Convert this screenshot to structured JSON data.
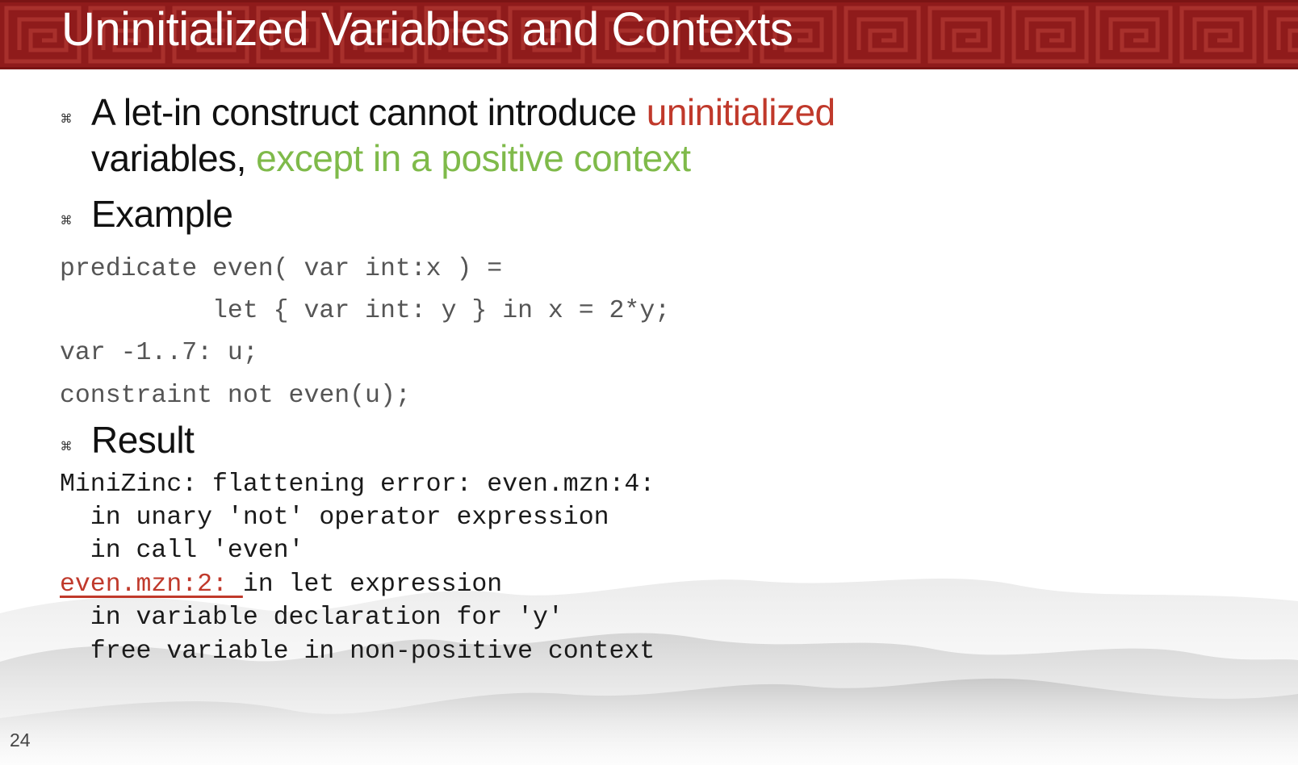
{
  "slide": {
    "title": "Uninitialized Variables and Contexts",
    "page_number": "24"
  },
  "bullets": [
    {
      "line1_a": "A let-in construct cannot introduce ",
      "line1_b": "uninitialized",
      "line2_a": "variables, ",
      "line2_b": "except in a positive context"
    },
    {
      "label": "Example"
    },
    {
      "label": "Result"
    }
  ],
  "example_code": [
    "predicate even( var int:x ) =",
    "          let { var int: y } in x = 2*y;",
    "var -1..7: u;",
    "constraint not even(u);"
  ],
  "result_output": {
    "line1": "MiniZinc: flattening error: even.mzn:4:",
    "line2": "  in unary 'not' operator expression",
    "line3": "  in call 'even'",
    "line4_link": "even.mzn:2: ",
    "line4_rest": "in let expression",
    "line5": "  in variable declaration for 'y'",
    "line6": "  free variable in non-positive context"
  },
  "colors": {
    "banner": "#8f1b1b",
    "highlight_red": "#c0392b",
    "highlight_green": "#7fba4a"
  }
}
